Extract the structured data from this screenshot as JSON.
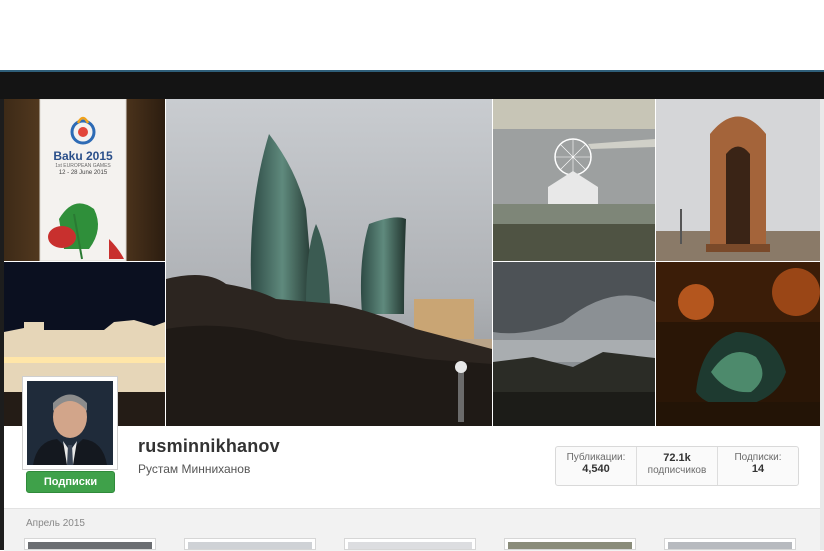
{
  "profile": {
    "username": "rusminnikhanov",
    "full_name": "Рустам Минниханов",
    "follow_label": "Подписки"
  },
  "stats": [
    {
      "label": "Публикации:",
      "value": "4,540"
    },
    {
      "label": "подписчиков",
      "value": "72.1k"
    },
    {
      "label": "Подписки:",
      "value": "14"
    }
  ],
  "feed": {
    "section_date": "Апрель 2015"
  },
  "photos": {
    "banner": {
      "title": "Baku 2015",
      "subtitle": "1st EUROPEAN GAMES",
      "dates": "12 - 28 June 2015"
    }
  },
  "icons": {
    "banner_logo": "flame-logo-icon",
    "pomegranate": "pomegranate-icon"
  },
  "colors": {
    "follow_button": "#3fa14a",
    "top_bar": "#141414",
    "accent_border": "#2f5f7a"
  }
}
